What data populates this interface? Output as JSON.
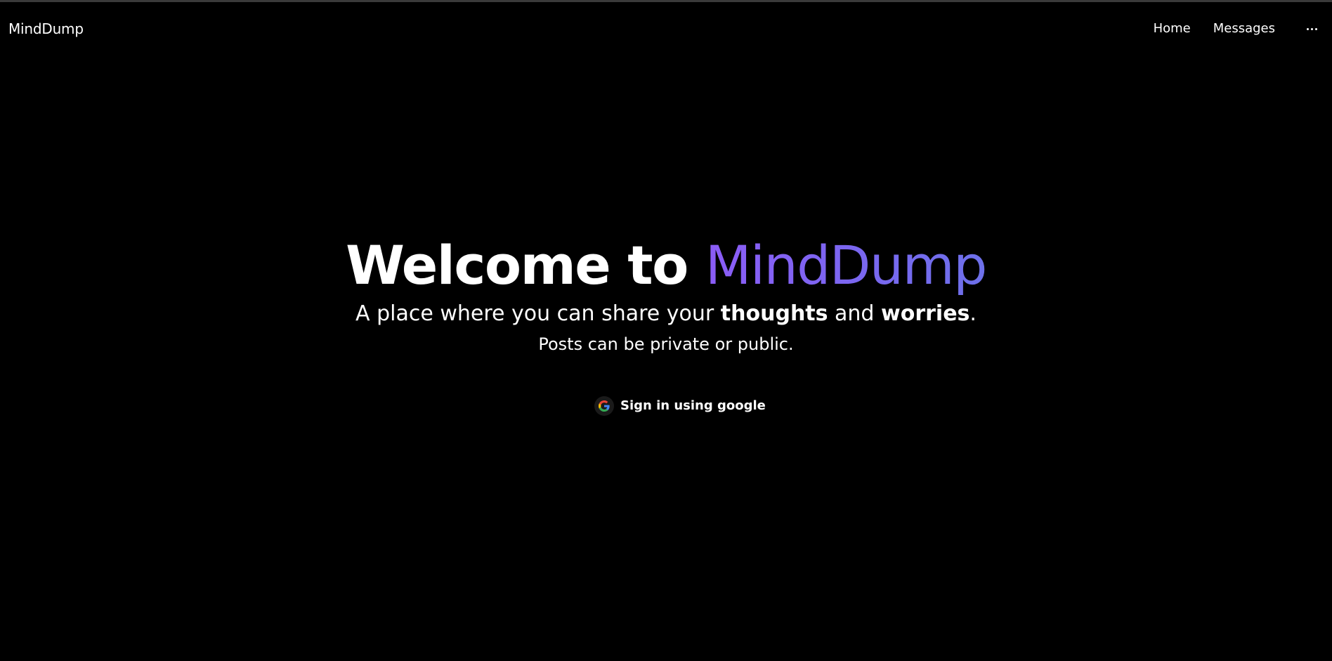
{
  "navbar": {
    "brand": "MindDump",
    "links": [
      {
        "label": "Home"
      },
      {
        "label": "Messages"
      }
    ],
    "more_icon": "ellipsis-icon"
  },
  "hero": {
    "headline_prefix": "Welcome to ",
    "headline_accent": "MindDump",
    "tagline_start": "A place where you can share your ",
    "tagline_bold1": "thoughts",
    "tagline_mid": " and ",
    "tagline_bold2": "worries",
    "tagline_end": ".",
    "subline": "Posts can be private or public."
  },
  "signin": {
    "label": "Sign in using google",
    "icon": "google-icon"
  },
  "colors": {
    "background": "#000000",
    "text": "#ffffff",
    "accent_start": "#8b5cf6",
    "accent_end": "#6d70ea"
  }
}
